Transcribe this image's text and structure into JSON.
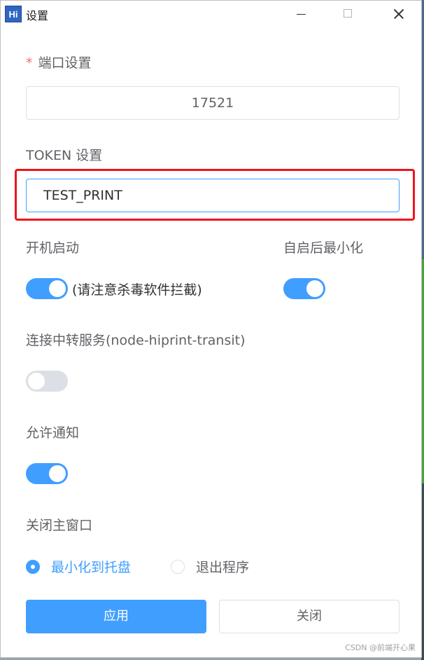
{
  "window": {
    "icon_text": "Hi",
    "title": "设置"
  },
  "port": {
    "required_mark": "*",
    "label": "端口设置",
    "value": "17521"
  },
  "token": {
    "label": "TOKEN 设置",
    "value": "TEST_PRINT"
  },
  "autostart": {
    "label": "开机启动",
    "checked": true,
    "note": "(请注意杀毒软件拦截)"
  },
  "minimize_after_start": {
    "label": "自启后最小化",
    "checked": true
  },
  "transit": {
    "label": "连接中转服务(node-hiprint-transit)",
    "checked": false
  },
  "notification": {
    "label": "允许通知",
    "checked": true
  },
  "close_main_window": {
    "label": "关闭主窗口",
    "options": [
      {
        "label": "最小化到托盘",
        "selected": true
      },
      {
        "label": "退出程序",
        "selected": false
      }
    ]
  },
  "buttons": {
    "apply": "应用",
    "close": "关闭"
  },
  "watermark": "CSDN @前端开心果",
  "colors": {
    "primary": "#409eff",
    "highlight": "#f0141e",
    "required": "#f56c6c"
  }
}
